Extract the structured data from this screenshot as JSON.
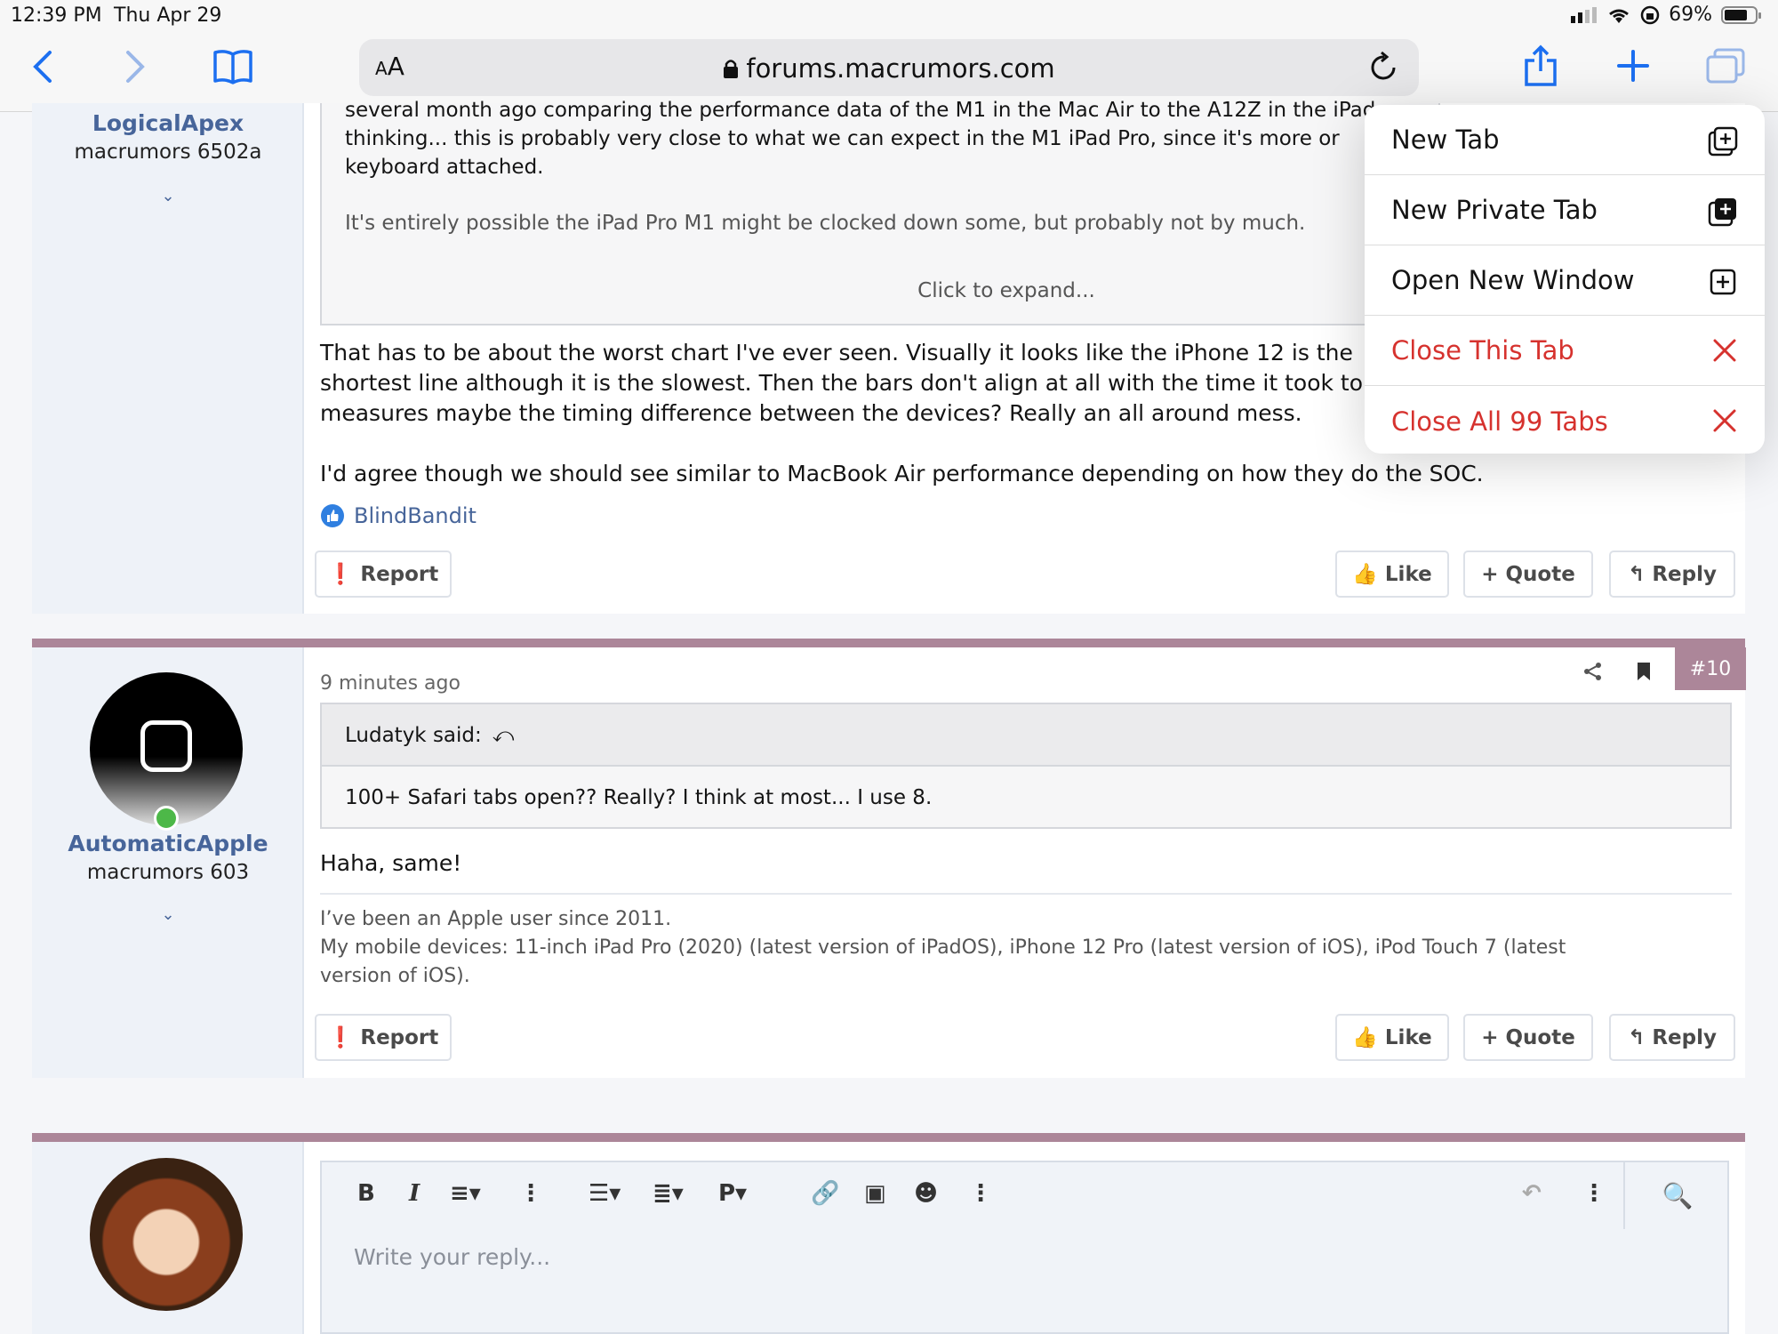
{
  "status_bar": {
    "time": "12:39 PM",
    "date": "Thu Apr 29",
    "battery": "69%"
  },
  "browser": {
    "aa_label": "AA",
    "url": "forums.macrumors.com"
  },
  "menu": {
    "items": [
      {
        "label": "New Tab",
        "icon": "new-tab-icon"
      },
      {
        "label": "New Private Tab",
        "icon": "new-private-tab-icon"
      },
      {
        "label": "Open New Window",
        "icon": "new-window-icon"
      },
      {
        "label": "Close This Tab",
        "icon": "close-icon",
        "color": "#d6322e"
      },
      {
        "label": "Close All 99 Tabs",
        "icon": "close-icon",
        "color": "#d6322e"
      }
    ]
  },
  "post1": {
    "user": {
      "name": "LogicalApex",
      "title": "macrumors 6502a"
    },
    "quote_lines": [
      "several month ago comparing the performance data of the M1 in the Mac Air to the A12Z in the iPad",
      "thinking... this is probably very close to what we can expect in the M1 iPad Pro, since it's more or",
      "keyboard attached.",
      "It's entirely possible the iPad Pro M1 might be clocked down some, but probably not by much."
    ],
    "expand": "Click to expand...",
    "body": [
      "That has to be about the worst chart I've ever seen. Visually it looks like the iPhone 12 is the",
      "shortest line although it is the slowest. Then the bars don't align at all with the time it took to",
      "measures maybe the timing difference between the devices? Really an all around mess.",
      "I'd agree though we should see similar to MacBook Air performance depending on how they do the SOC."
    ],
    "reaction_user": "BlindBandit",
    "report": "Report",
    "like": "Like",
    "quote": "+ Quote",
    "reply": "Reply"
  },
  "post2": {
    "user": {
      "name": "AutomaticApple",
      "title": "macrumors 603"
    },
    "time": "9 minutes ago",
    "post_number": "#10",
    "quote_author": "Ludatyk said:",
    "quote_text": "100+ Safari tabs open?? Really? I think at most... I use 8.",
    "body": "Haha, same!",
    "signature": [
      "I’ve been an Apple user since 2011.",
      "My mobile devices: 11-inch iPad Pro (2020) (latest version of iPadOS), iPhone 12 Pro (latest version of iOS), iPod Touch 7 (latest",
      "version of iOS)."
    ],
    "report": "Report",
    "like": "Like",
    "quote": "+ Quote",
    "reply": "Reply"
  },
  "editor": {
    "placeholder": "Write your reply..."
  },
  "colors": {
    "accent": "#1c6ff0",
    "post_border": "#ac8699",
    "username": "#47659a",
    "danger": "#d6322e"
  }
}
